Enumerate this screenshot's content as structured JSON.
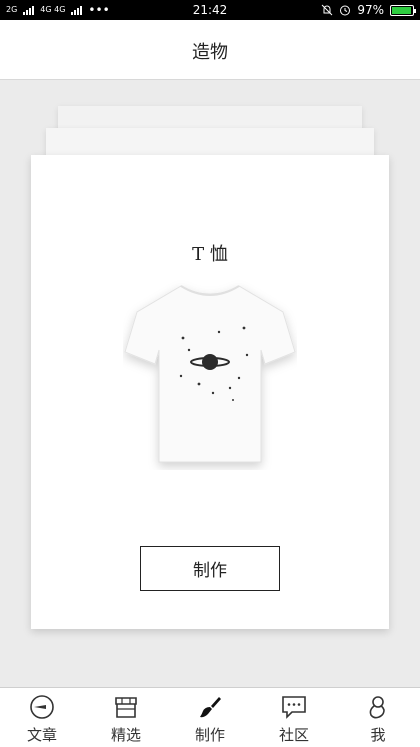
{
  "status_bar": {
    "network_left": "2G",
    "network_right": "4G 4G",
    "dots": "•••",
    "time": "21:42",
    "battery_percent": "97%",
    "battery_level": 0.97,
    "icons": [
      "signal-icon",
      "mute-bell-icon",
      "alarm-icon",
      "battery-charging-icon"
    ]
  },
  "header": {
    "title": "造物"
  },
  "card": {
    "product_title": "T 恤",
    "image_icon": "tshirt-planet-image",
    "make_label": "制作"
  },
  "tabbar": {
    "items": [
      {
        "label": "文章",
        "icon": "article-icon"
      },
      {
        "label": "精选",
        "icon": "shop-icon"
      },
      {
        "label": "制作",
        "icon": "brush-icon",
        "active": true
      },
      {
        "label": "社区",
        "icon": "chat-icon"
      },
      {
        "label": "我",
        "icon": "profile-icon"
      }
    ]
  }
}
